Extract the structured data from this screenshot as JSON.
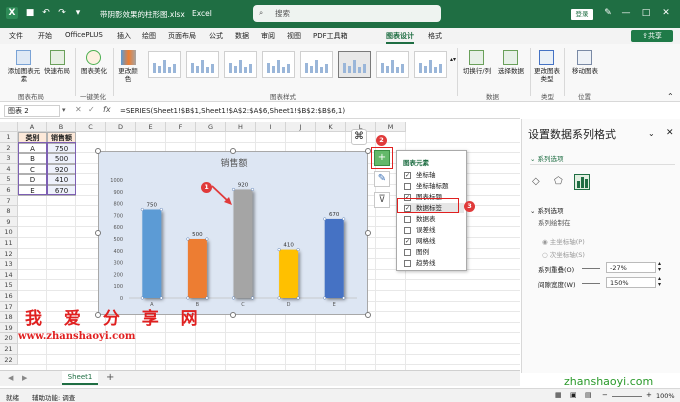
{
  "titlebar": {
    "autosave_icon": "save-icon",
    "filename": "带阴影效果的柱形图.xlsx",
    "app": "Excel",
    "search_placeholder": "搜索",
    "login": "登录"
  },
  "menu": {
    "items": [
      "文件",
      "开始",
      "OfficePLUS",
      "插入",
      "绘图",
      "页面布局",
      "公式",
      "数据",
      "审阅",
      "视图",
      "PDF工具箱",
      "图表设计",
      "格式"
    ],
    "active": "图表设计",
    "share": "共享"
  },
  "ribbon": {
    "add_element": "添加图表元素",
    "quick_layout": "快速布局",
    "group_layout": "图表布局",
    "beautify": "图表美化",
    "group_beautify": "一键美化",
    "change_colors": "更改颜色",
    "group_styles": "图表样式",
    "switch_rowcol": "切换行/列",
    "select_data": "选择数据",
    "group_data": "数据",
    "change_type": "更改图表类型",
    "group_type": "类型",
    "move_chart": "移动图表",
    "group_location": "位置"
  },
  "formula_bar": {
    "name_box": "图表 2",
    "fx": "fx",
    "formula": "=SERIES(Sheet1!$B$1,Sheet1!$A$2:$A$6,Sheet1!$B$2:$B$6,1)"
  },
  "grid": {
    "columns": [
      "A",
      "B",
      "C",
      "D",
      "E",
      "F",
      "G",
      "H",
      "I",
      "J",
      "K",
      "L",
      "M"
    ],
    "rows": [
      "1",
      "2",
      "3",
      "4",
      "5",
      "6",
      "7",
      "8",
      "9",
      "10",
      "11",
      "12",
      "13",
      "14",
      "15",
      "16",
      "17",
      "18",
      "19",
      "20",
      "21",
      "22"
    ],
    "table": {
      "header": [
        "类别",
        "销售额"
      ],
      "rows": [
        [
          "A",
          "750"
        ],
        [
          "B",
          "500"
        ],
        [
          "C",
          "920"
        ],
        [
          "D",
          "410"
        ],
        [
          "E",
          "670"
        ]
      ]
    }
  },
  "chart_data": {
    "type": "bar",
    "title": "销售额",
    "categories": [
      "A",
      "B",
      "C",
      "D",
      "E"
    ],
    "values": [
      750,
      500,
      920,
      410,
      670
    ],
    "colors": [
      "#5b9bd5",
      "#ed7d31",
      "#a5a5a5",
      "#ffc000",
      "#4472c4"
    ],
    "ylim": [
      0,
      1000
    ],
    "yticks": [
      "0",
      "100",
      "200",
      "300",
      "400",
      "500",
      "600",
      "700",
      "800",
      "900",
      "1000"
    ],
    "data_labels": true,
    "grid": false
  },
  "chart_elements_popup": {
    "title": "图表元素",
    "items": [
      {
        "label": "坐标轴",
        "checked": true
      },
      {
        "label": "坐标轴标题",
        "checked": false
      },
      {
        "label": "图表标题",
        "checked": true
      },
      {
        "label": "数据标签",
        "checked": true
      },
      {
        "label": "数据表",
        "checked": false
      },
      {
        "label": "误差线",
        "checked": false
      },
      {
        "label": "网格线",
        "checked": true
      },
      {
        "label": "图例",
        "checked": false
      },
      {
        "label": "趋势线",
        "checked": false
      }
    ]
  },
  "markers": [
    "1",
    "2",
    "3"
  ],
  "watermark": {
    "cn": "我 爱 分 享 网",
    "url": "www.zhanshaoyi.com",
    "corner": "zhanshaoyi.com"
  },
  "format_pane": {
    "title": "设置数据系列格式",
    "section_tab": "系列选项",
    "section": "系列选项",
    "plot_on": "系列绘制在",
    "primary_axis": "主坐标轴(P)",
    "secondary_axis": "次坐标轴(S)",
    "overlap_label": "系列重叠(O)",
    "overlap_value": "-27%",
    "gap_label": "间隙宽度(W)",
    "gap_value": "150%"
  },
  "sheet_tabs": {
    "sheet": "Sheet1",
    "add": "+"
  },
  "status_bar": {
    "ready": "就绪",
    "accessibility": "辅助功能: 调查",
    "zoom": "100%"
  },
  "colors": {
    "excel_green": "#1f6e43",
    "marker_red": "#e03a3a"
  }
}
